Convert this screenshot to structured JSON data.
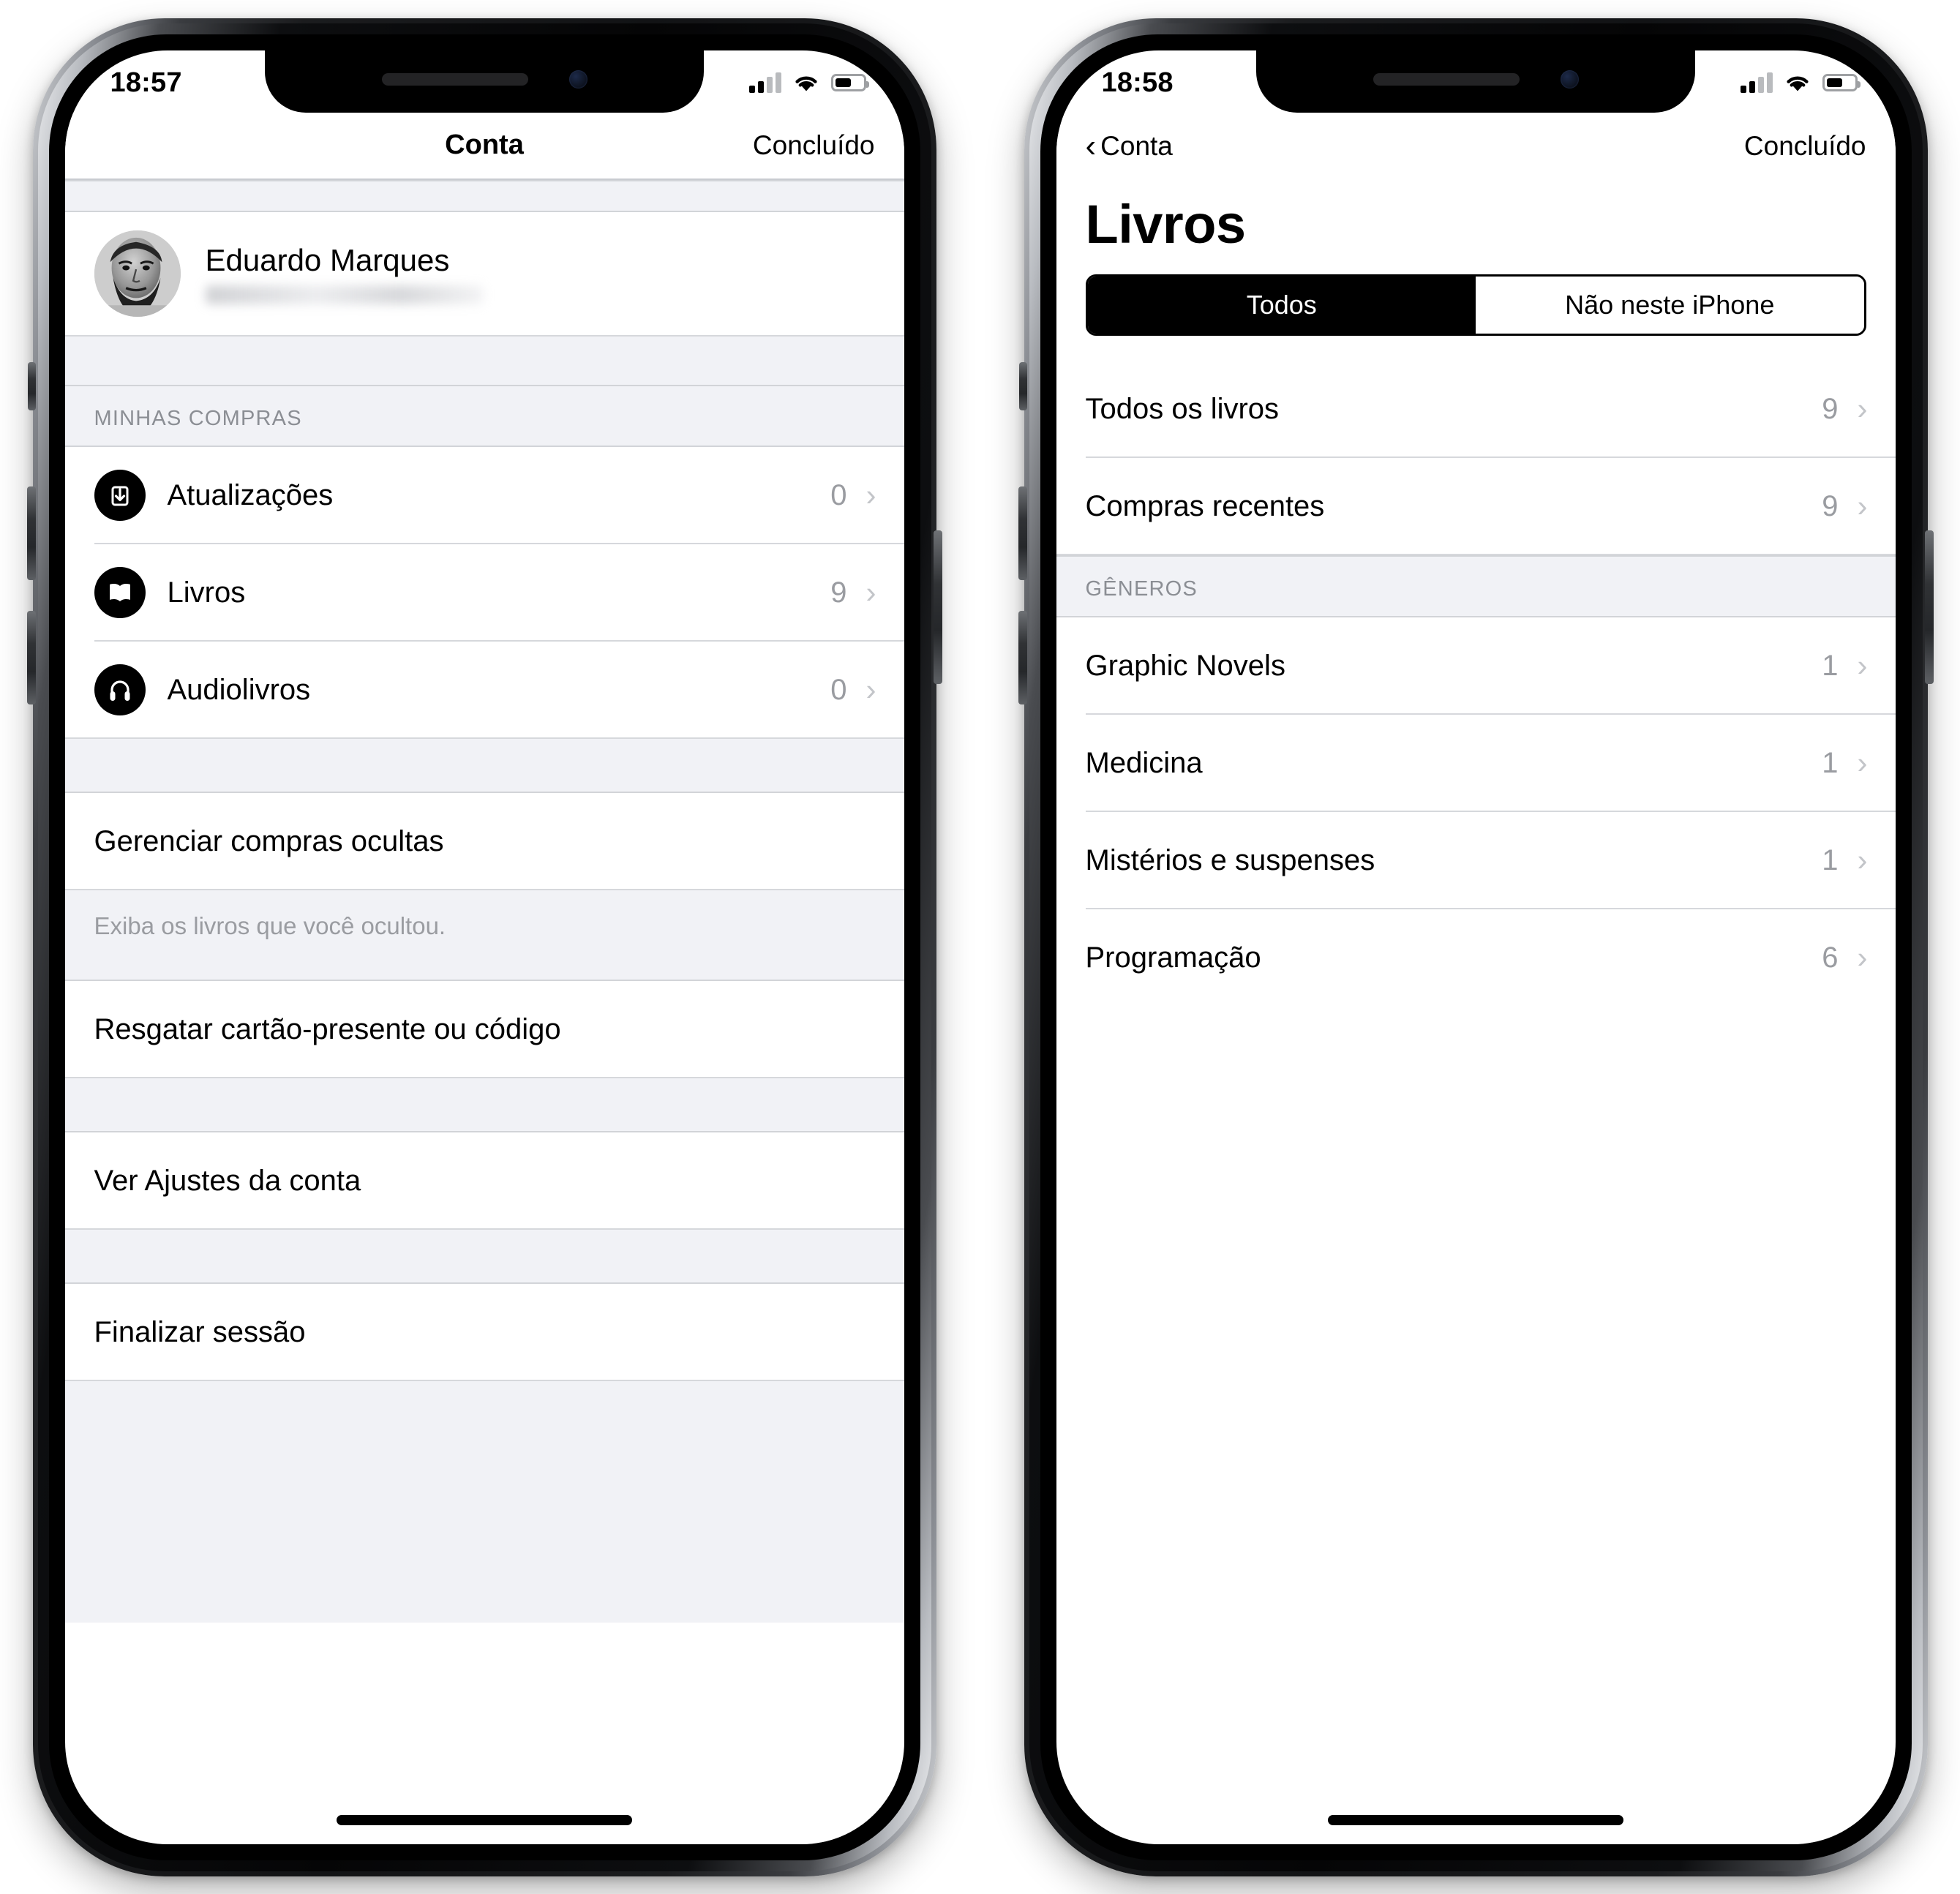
{
  "phones": [
    {
      "name": "account-screen",
      "status_bar": {
        "time": "18:57",
        "signal_icon": "cellular-signal-icon",
        "wifi_icon": "wifi-icon",
        "battery_icon": "battery-icon"
      },
      "navbar": {
        "title": "Conta",
        "right_button": "Concluído"
      },
      "profile": {
        "name": "Eduardo Marques",
        "email_redacted": true
      },
      "purchases_section": {
        "header": "MINHAS COMPRAS",
        "rows": [
          {
            "label": "Atualizações",
            "count": "0",
            "icon": "download-icon"
          },
          {
            "label": "Livros",
            "count": "9",
            "icon": "book-icon"
          },
          {
            "label": "Audiolivros",
            "count": "0",
            "icon": "headphones-icon"
          }
        ]
      },
      "hidden_purchases": {
        "label": "Gerenciar compras ocultas",
        "footer": "Exiba os livros que você ocultou."
      },
      "redeem": {
        "label": "Resgatar cartão-presente ou código"
      },
      "account_settings": {
        "label": "Ver Ajustes da conta"
      },
      "sign_out": {
        "label": "Finalizar sessão"
      }
    },
    {
      "name": "books-screen",
      "status_bar": {
        "time": "18:58",
        "signal_icon": "cellular-signal-icon",
        "wifi_icon": "wifi-icon",
        "battery_icon": "battery-icon"
      },
      "navbar": {
        "back_label": "Conta",
        "back_icon": "chevron-left-icon",
        "right_button": "Concluído"
      },
      "large_title": "Livros",
      "segmented": {
        "options": [
          "Todos",
          "Não neste iPhone"
        ],
        "selected_index": 0
      },
      "top_rows": [
        {
          "label": "Todos os livros",
          "count": "9"
        },
        {
          "label": "Compras recentes",
          "count": "9"
        }
      ],
      "genres_section": {
        "header": "GÊNEROS",
        "rows": [
          {
            "label": "Graphic Novels",
            "count": "1"
          },
          {
            "label": "Medicina",
            "count": "1"
          },
          {
            "label": "Mistérios e suspenses",
            "count": "1"
          },
          {
            "label": "Programação",
            "count": "6"
          }
        ]
      }
    }
  ],
  "colors": {
    "accent": "#000000",
    "group_background": "#f1f2f6",
    "separator": "#d6d8dc",
    "secondary_text": "#9a9ca1",
    "chevron": "#c3c5c9"
  },
  "glyphs": {
    "chevron_right": "›",
    "chevron_left": "‹"
  }
}
